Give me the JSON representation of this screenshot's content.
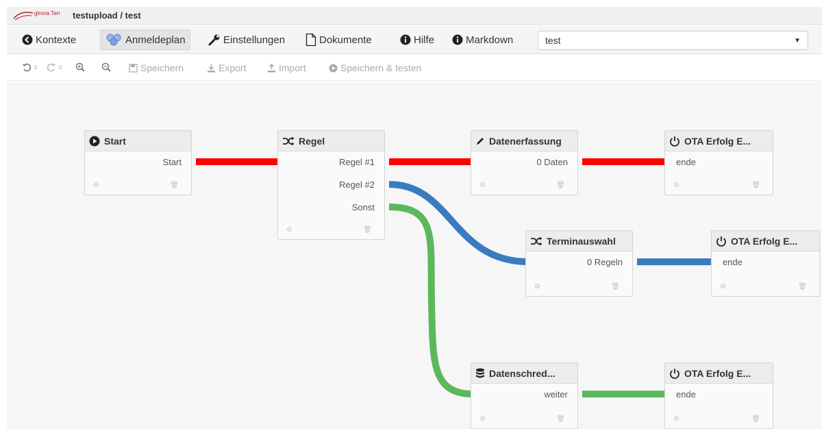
{
  "window": {
    "title": "testupload / test",
    "logo_text": "girona Termin"
  },
  "nav": {
    "items": [
      {
        "label": "Kontexte",
        "icon": "arrow-left-circle-icon"
      },
      {
        "label": "Anmeldeplan",
        "icon": "network-icon",
        "active": true
      },
      {
        "label": "Einstellungen",
        "icon": "wrench-icon"
      },
      {
        "label": "Dokumente",
        "icon": "document-icon"
      },
      {
        "label": "Hilfe",
        "icon": "info-icon"
      },
      {
        "label": "Markdown",
        "icon": "info-icon"
      }
    ],
    "select_value": "test"
  },
  "toolbar": {
    "undo_count": "0",
    "redo_count": "0",
    "save": "Speichern",
    "export": "Export",
    "import": "Import",
    "save_test": "Speichern & testen"
  },
  "nodes": {
    "start": {
      "title": "Start",
      "outputs": [
        "Start"
      ]
    },
    "regel": {
      "title": "Regel",
      "outputs": [
        "Regel #1",
        "Regel #2",
        "Sonst"
      ]
    },
    "datenerfassung": {
      "title": "Datenerfassung",
      "outputs": [
        "0 Daten"
      ]
    },
    "ota1": {
      "title": "OTA Erfolg E...",
      "inputs": [
        "ende"
      ]
    },
    "terminauswahl": {
      "title": "Terminauswahl",
      "outputs": [
        "0 Regeln"
      ]
    },
    "ota2": {
      "title": "OTA Erfolg E...",
      "inputs": [
        "ende"
      ]
    },
    "datenschred": {
      "title": "Datenschred...",
      "outputs": [
        "weiter"
      ]
    },
    "ota3": {
      "title": "OTA Erfolg E...",
      "inputs": [
        "ende"
      ]
    }
  },
  "colors": {
    "red_link": "#ff0000",
    "blue_link": "#3a7bbf",
    "green_link": "#5cb85c",
    "canvas": "#f6f6f6"
  }
}
